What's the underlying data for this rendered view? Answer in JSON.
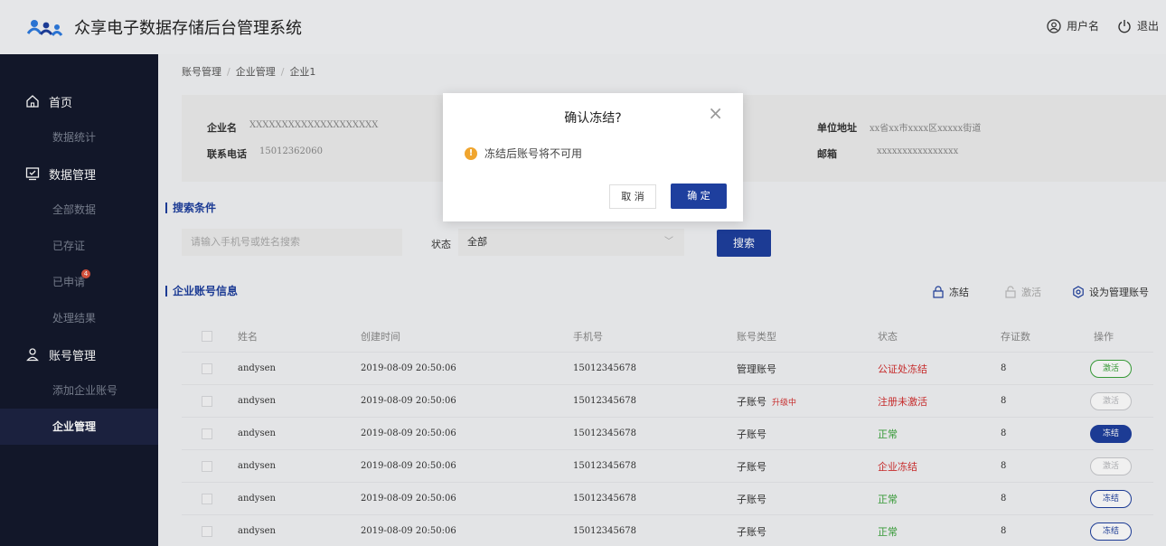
{
  "app": {
    "title": "众享电子数据存储后台管理系统",
    "user_label": "用户名",
    "logout_label": "退出"
  },
  "sidebar": {
    "groups": [
      {
        "label": "首页",
        "icon": "home-icon",
        "items": [
          {
            "label": "数据统计"
          }
        ]
      },
      {
        "label": "数据管理",
        "icon": "monitor-check-icon",
        "items": [
          {
            "label": "全部数据"
          },
          {
            "label": "已存证"
          },
          {
            "label": "已申请",
            "badge": "4"
          },
          {
            "label": "处理结果"
          }
        ]
      },
      {
        "label": "账号管理",
        "icon": "user-icon",
        "items": [
          {
            "label": "添加企业账号"
          },
          {
            "label": "企业管理",
            "active": true
          }
        ]
      }
    ]
  },
  "breadcrumb": [
    "账号管理",
    "企业管理",
    "企业1"
  ],
  "info": {
    "company_label": "企业名",
    "company_value": "XXXXXXXXXXXXXXXXXXXX",
    "phone_label": "联系电话",
    "phone_value": "15012362060",
    "address_label": "单位地址",
    "address_value": "xx省xx市xxxx区xxxxx街道",
    "email_label": "邮箱",
    "email_value": "xxxxxxxxxxxxxxxx"
  },
  "search": {
    "section_title": "搜索条件",
    "placeholder": "请输入手机号或姓名搜索",
    "status_label": "状态",
    "status_value": "全部",
    "button": "搜索"
  },
  "accounts": {
    "section_title": "企业账号信息",
    "action_freeze": "冻结",
    "action_activate": "激活",
    "action_set_admin": "设为管理账号",
    "columns": [
      "姓名",
      "创建时间",
      "手机号",
      "账号类型",
      "状态",
      "存证数",
      "操作"
    ],
    "rows": [
      {
        "name": "andysen",
        "time": "2019-08-09 20:50:06",
        "phone": "15012345678",
        "type": "管理账号",
        "tag": "",
        "status": "公证处冻结",
        "status_color": "red",
        "count": "8",
        "op": "激活",
        "op_style": "activate"
      },
      {
        "name": "andysen",
        "time": "2019-08-09 20:50:06",
        "phone": "15012345678",
        "type": "子账号",
        "tag": "升级中",
        "status": "注册未激活",
        "status_color": "red",
        "count": "8",
        "op": "激活",
        "op_style": "disabled"
      },
      {
        "name": "andysen",
        "time": "2019-08-09 20:50:06",
        "phone": "15012345678",
        "type": "子账号",
        "tag": "",
        "status": "正常",
        "status_color": "green",
        "count": "8",
        "op": "冻结",
        "op_style": "freeze-solid"
      },
      {
        "name": "andysen",
        "time": "2019-08-09 20:50:06",
        "phone": "15012345678",
        "type": "子账号",
        "tag": "",
        "status": "企业冻结",
        "status_color": "red",
        "count": "8",
        "op": "激活",
        "op_style": "disabled"
      },
      {
        "name": "andysen",
        "time": "2019-08-09 20:50:06",
        "phone": "15012345678",
        "type": "子账号",
        "tag": "",
        "status": "正常",
        "status_color": "green",
        "count": "8",
        "op": "冻结",
        "op_style": "freeze-outline"
      },
      {
        "name": "andysen",
        "time": "2019-08-09 20:50:06",
        "phone": "15012345678",
        "type": "子账号",
        "tag": "",
        "status": "正常",
        "status_color": "green",
        "count": "8",
        "op": "冻结",
        "op_style": "freeze-outline"
      }
    ]
  },
  "modal": {
    "title": "确认冻结?",
    "message": "冻结后账号将不可用",
    "cancel": "取 消",
    "confirm": "确 定"
  },
  "colors": {
    "primary": "#1e3f9e",
    "sidebar_bg": "#14192c",
    "danger": "#d32f2f",
    "success": "#3aa33a",
    "warning": "#f0a52e"
  }
}
